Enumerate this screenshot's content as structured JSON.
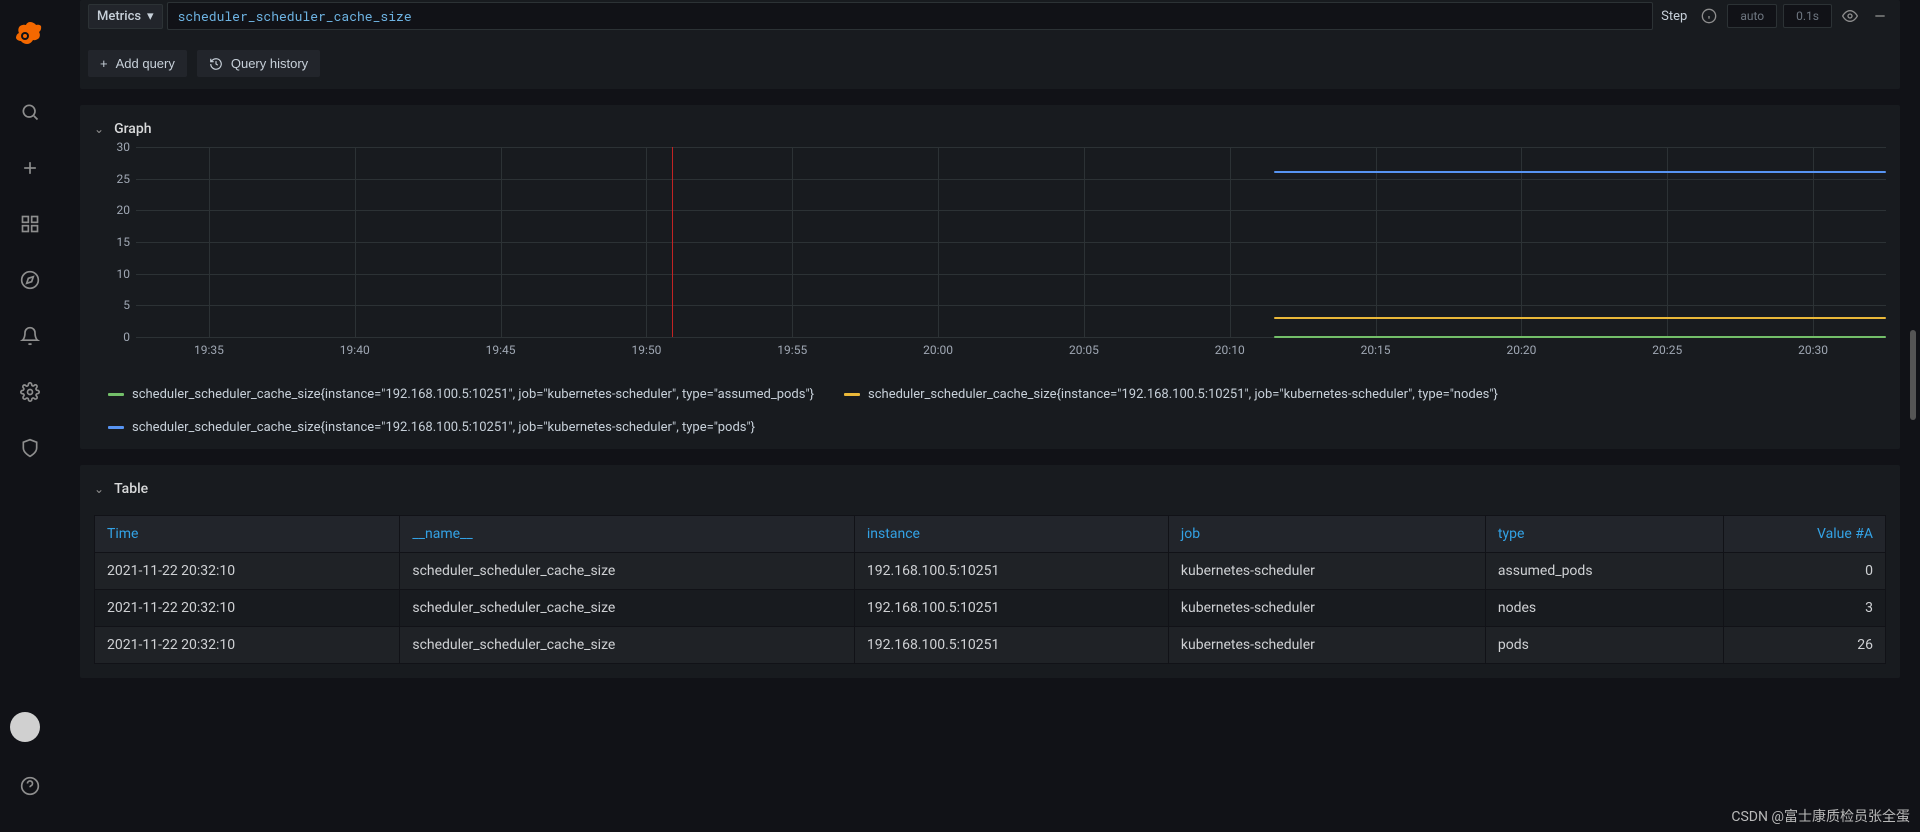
{
  "sidebar": {
    "icons": [
      "search-icon",
      "plus-icon",
      "dashboards-icon",
      "explore-icon",
      "alerting-icon",
      "configuration-icon",
      "admin-icon"
    ]
  },
  "query": {
    "metrics_label": "Metrics",
    "expression": "scheduler_scheduler_cache_size",
    "step_label": "Step",
    "step_value": "auto",
    "exec_time": "0.1s"
  },
  "actions": {
    "add_query": "Add query",
    "query_history": "Query history"
  },
  "graph": {
    "title": "Graph",
    "cursor_x_pct": 30.6,
    "legend": [
      {
        "color": "#73bf69",
        "label": "scheduler_scheduler_cache_size{instance=\"192.168.100.5:10251\", job=\"kubernetes-scheduler\", type=\"assumed_pods\"}"
      },
      {
        "color": "#eab839",
        "label": "scheduler_scheduler_cache_size{instance=\"192.168.100.5:10251\", job=\"kubernetes-scheduler\", type=\"nodes\"}"
      },
      {
        "color": "#5794f2",
        "label": "scheduler_scheduler_cache_size{instance=\"192.168.100.5:10251\", job=\"kubernetes-scheduler\", type=\"pods\"}"
      }
    ]
  },
  "chart_data": {
    "type": "line",
    "xlabel": "",
    "ylabel": "",
    "ylim": [
      0,
      30
    ],
    "x_ticks": [
      "19:35",
      "19:40",
      "19:45",
      "19:50",
      "19:55",
      "20:00",
      "20:05",
      "20:10",
      "20:15",
      "20:20",
      "20:25",
      "20:30"
    ],
    "y_ticks": [
      0,
      5,
      10,
      15,
      20,
      25,
      30
    ],
    "data_start_x": "20:11",
    "data_start_pct": 65.0,
    "series": [
      {
        "name": "assumed_pods",
        "color": "#73bf69",
        "value": 0
      },
      {
        "name": "nodes",
        "color": "#eab839",
        "value": 3
      },
      {
        "name": "pods",
        "color": "#5794f2",
        "value": 26
      }
    ]
  },
  "table": {
    "title": "Table",
    "headers": [
      "Time",
      "__name__",
      "instance",
      "job",
      "type",
      "Value #A"
    ],
    "rows": [
      {
        "time": "2021-11-22 20:32:10",
        "name": "scheduler_scheduler_cache_size",
        "instance": "192.168.100.5:10251",
        "job": "kubernetes-scheduler",
        "type": "assumed_pods",
        "value": "0"
      },
      {
        "time": "2021-11-22 20:32:10",
        "name": "scheduler_scheduler_cache_size",
        "instance": "192.168.100.5:10251",
        "job": "kubernetes-scheduler",
        "type": "nodes",
        "value": "3"
      },
      {
        "time": "2021-11-22 20:32:10",
        "name": "scheduler_scheduler_cache_size",
        "instance": "192.168.100.5:10251",
        "job": "kubernetes-scheduler",
        "type": "pods",
        "value": "26"
      }
    ]
  },
  "watermark": "CSDN @富士康质检员张全蛋"
}
